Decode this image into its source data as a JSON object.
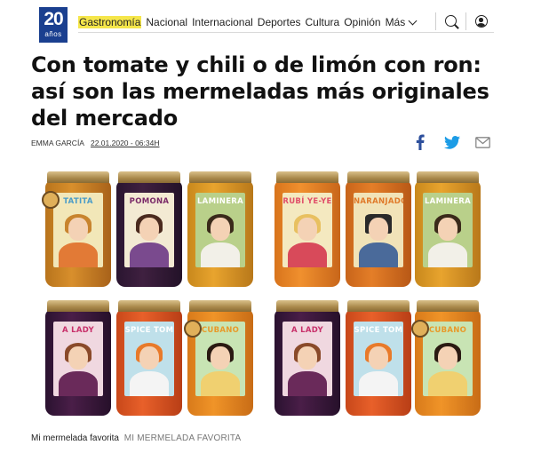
{
  "logo": {
    "number": "20",
    "suffix": "años"
  },
  "nav": {
    "items": [
      {
        "label": "Gastronomía",
        "active": true
      },
      {
        "label": "Nacional",
        "active": false
      },
      {
        "label": "Internacional",
        "active": false
      },
      {
        "label": "Deportes",
        "active": false
      },
      {
        "label": "Cultura",
        "active": false
      },
      {
        "label": "Opinión",
        "active": false
      }
    ],
    "more_label": "Más",
    "icons": [
      "search-icon",
      "user-icon",
      "chevron-down-icon"
    ]
  },
  "article": {
    "headline": "Con tomate y chili o de limón con ron: así son las mermeladas más originales del mercado",
    "author": "Emma García",
    "date": "22.01.2020 - 06:34H",
    "share_icons": [
      "facebook-icon",
      "twitter-icon",
      "mail-icon"
    ]
  },
  "photo": {
    "jar_labels_top": [
      "TATITA",
      "POMONA",
      "LAMINERA",
      "RUBÍ YE-YE",
      "NARANJADO",
      "LAMINERA"
    ],
    "jar_labels_bottom": [
      "A LADY",
      "SPICE TOM",
      "CUBANO",
      "A LADY",
      "SPICE TOM",
      "CUBANO"
    ]
  },
  "caption": {
    "text": "Mi mermelada favorita",
    "credit": "Mi mermelada favorita"
  },
  "colors": {
    "logo_blue": "#1a3f8f",
    "active_highlight": "#f5e64a",
    "twitter": "#1c9ce6",
    "facebook": "#2d4f9c"
  }
}
